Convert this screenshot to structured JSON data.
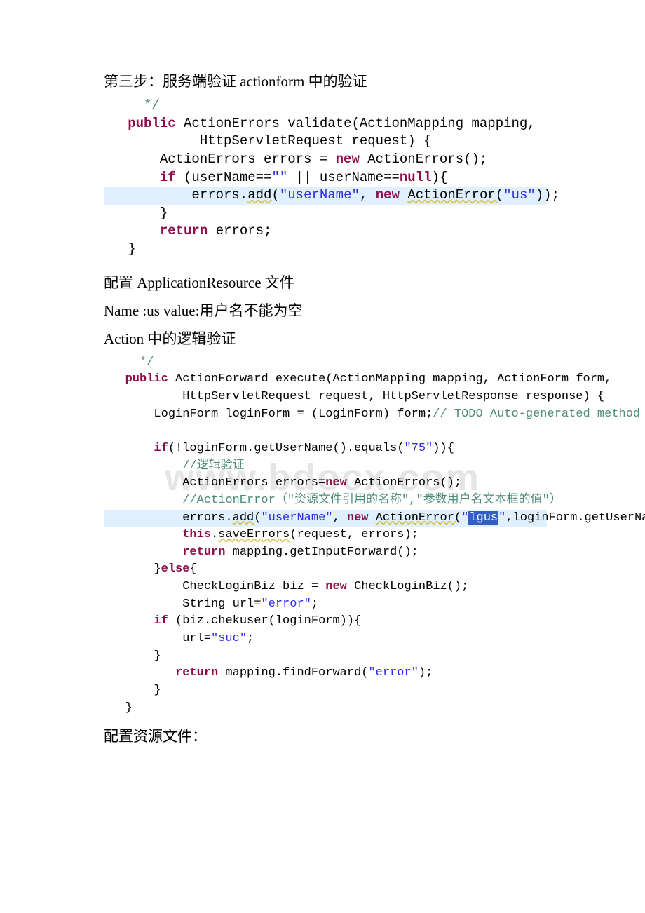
{
  "heading1": "第三步：服务端验证 actionform 中的验证",
  "code1": {
    "l1a": "     */",
    "l2_kw": "   public",
    "l2_rest": " ActionErrors validate(ActionMapping mapping,",
    "l3": "            HttpServletRequest request) {",
    "l4a": "       ActionErrors errors = ",
    "l4_kw": "new",
    "l4b": " ActionErrors();",
    "l5_kw": "       if",
    "l5a": " (userName==",
    "l5s1": "\"\"",
    "l5b": " || userName==",
    "l5_kw2": "null",
    "l5c": "){",
    "l6a": "           errors.",
    "l6m": "add",
    "l6b": "(",
    "l6s1": "\"userName\"",
    "l6c": ", ",
    "l6_kw": "new",
    "l6d": " ",
    "l6w": "ActionError(",
    "l6s2": "\"us\"",
    "l6e": "));",
    "l7": "       }",
    "l8_kw": "       return",
    "l8a": " errors;",
    "l9": "   }"
  },
  "para2": "配置 ApplicationResource 文件",
  "para3a": "Name :us value:",
  "para3b": "用户名不能为空",
  "para4a": "Action",
  "para4b": " 中的逻辑验证",
  "code2": {
    "l1": "     */",
    "l2_kw": "   public",
    "l2a": " ActionForward execute(ActionMapping mapping, ActionForm form,",
    "l3": "           HttpServletRequest request, HttpServletResponse response) {",
    "l4a": "       LoginForm loginForm = (LoginForm) form;",
    "l4c": "// TODO Auto-generated method stub",
    "l5": "",
    "l6_kw": "       if",
    "l6a": "(!loginForm.getUserName().equals(",
    "l6s": "\"75\"",
    "l6b": ")){",
    "l7": "           //逻辑验证",
    "l8a": "           ActionErrors errors=",
    "l8_kw": "new",
    "l8b": " ActionErrors();",
    "l9": "           //ActionError（\"资源文件引用的名称\",\"参数用户名文本框的值\"）",
    "l10a": "           errors.",
    "l10m": "add",
    "l10b": "(",
    "l10s1": "\"userName\"",
    "l10c": ", ",
    "l10_kw": "new",
    "l10d": " ",
    "l10w": "ActionError(",
    "l10s2a": "\"",
    "l10sel": "lgus",
    "l10s2b": "\"",
    "l10e": ",loginForm.getUserName()))",
    "l11_kw": "           this",
    "l11a": ".",
    "l11m": "saveErrors",
    "l11b": "(request, errors);",
    "l12_kw": "           return",
    "l12a": " mapping.getInputForward();",
    "l13a": "       }",
    "l13_kw": "else",
    "l13b": "{",
    "l14a": "           CheckLoginBiz biz = ",
    "l14_kw": "new",
    "l14b": " CheckLoginBiz();",
    "l15a": "           String url=",
    "l15s": "\"error\"",
    "l15b": ";",
    "l16_kw": "       if",
    "l16a": " (biz.chekuser(loginForm)){",
    "l17a": "           url=",
    "l17s": "\"suc\"",
    "l17b": ";",
    "l18": "       }",
    "l19_kw": "          return",
    "l19a": " mapping.findForward(",
    "l19s": "\"error\"",
    "l19b": ");",
    "l20": "       }",
    "l21": "   }"
  },
  "para5": "配置资源文件：",
  "watermark": "www.bdocx.com"
}
